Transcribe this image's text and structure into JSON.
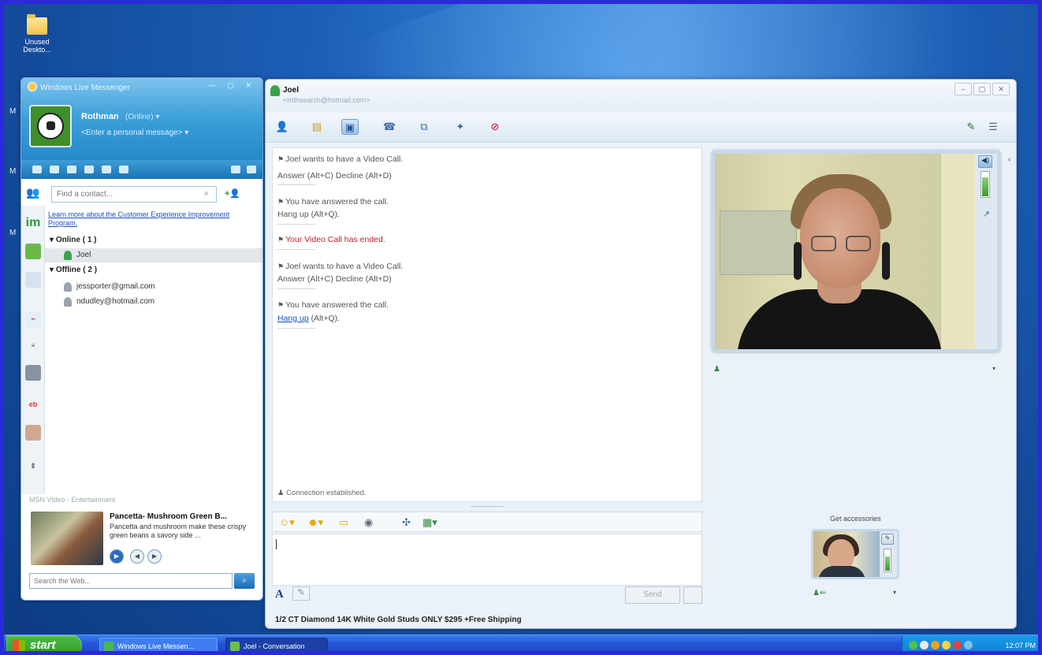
{
  "desktop": {
    "icon_label": "Unused Deskto...",
    "side_letters": [
      "M",
      "M",
      "M"
    ]
  },
  "messenger": {
    "title": "Windows Live Messenger",
    "user_name": "Rothman",
    "user_status": "(Online)",
    "personal_message": "<Enter a personal message>",
    "search_placeholder": "Find a contact...",
    "info_link": "Learn more about the Customer Experience Improvement Program.",
    "groups": [
      {
        "label": "Online ( 1 )",
        "contacts": [
          "Joel"
        ]
      },
      {
        "label": "Offline ( 2 )",
        "contacts": [
          "jessporter@gmail.com",
          "ndudley@hotmail.com"
        ]
      }
    ],
    "ad": {
      "label": "MSN Video - Entertainment",
      "title": "Pancetta- Mushroom Green B...",
      "text": "Pancetta and mushroom make these crispy green beans a savory side ..."
    },
    "web_search_placeholder": "Search the Web..."
  },
  "conversation": {
    "contact_name": "Joel",
    "contact_email": "<rothsearch@hotmail.com>",
    "transcript": [
      {
        "text": "Joel wants to have a Video Call.",
        "style": "normal"
      },
      {
        "text": "Answer (Alt+C)  Decline (Alt+D)",
        "style": "normal"
      },
      {
        "text": "You have answered the call.",
        "style": "normal"
      },
      {
        "text": "Hang up (Alt+Q).",
        "style": "normal"
      },
      {
        "text": "Your Video Call has ended.",
        "style": "red"
      },
      {
        "text": "Joel wants to have a Video Call.",
        "style": "normal"
      },
      {
        "text": "Answer (Alt+C)  Decline (Alt+D)",
        "style": "normal"
      },
      {
        "text": "You have answered the call.",
        "style": "normal"
      },
      {
        "link": "Hang up",
        "text": " (Alt+Q)."
      }
    ],
    "connection_status": "Connection established.",
    "send_label": "Send",
    "ad_text": "1/2 CT Diamond 14K White Gold Studs ONLY $295 +Free Shipping",
    "accessories_label": "Get accessories"
  },
  "taskbar": {
    "start_label": "start",
    "tasks": [
      "Windows Live Messen...",
      "Joel - Conversation"
    ],
    "clock": "12:07 PM"
  },
  "colors": {
    "desktop_blue": "#1c5fb6",
    "messenger_header": "#3b9fd8",
    "ended_red": "#c0202a",
    "link_blue": "#1a4fb8",
    "start_green": "#3aa93a"
  }
}
